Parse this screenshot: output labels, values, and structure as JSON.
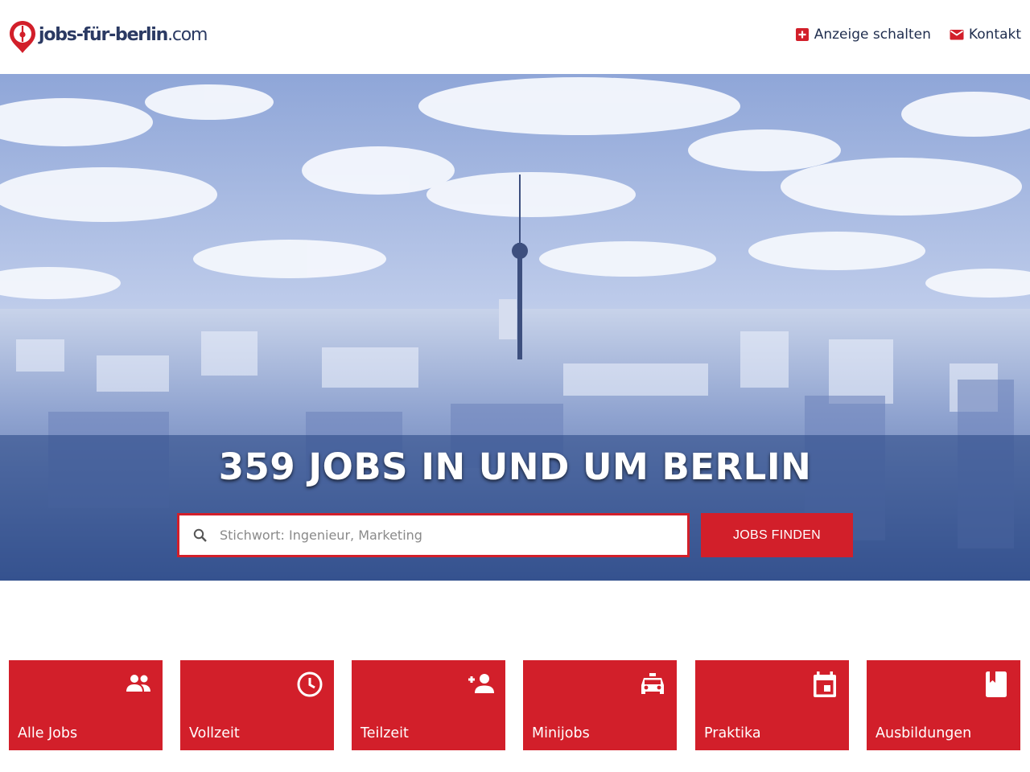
{
  "brand": {
    "name": "jobs-für-berlin",
    "tld": ".com",
    "accent_color": "#d21f2a",
    "text_color": "#2b3a63"
  },
  "nav": {
    "items": [
      {
        "label": "Anzeige schalten",
        "icon": "plus-box-icon"
      },
      {
        "label": "Kontakt",
        "icon": "mail-icon"
      }
    ]
  },
  "hero": {
    "title": "359 JOBS IN UND UM BERLIN",
    "search_placeholder": "Stichwort: Ingenieur, Marketing",
    "search_value": "",
    "search_button": "JOBS FINDEN",
    "search_icon": "search-icon"
  },
  "categories": [
    {
      "label": "Alle Jobs",
      "icon": "people-icon"
    },
    {
      "label": "Vollzeit",
      "icon": "clock-icon"
    },
    {
      "label": "Teilzeit",
      "icon": "person-add-icon"
    },
    {
      "label": "Minijobs",
      "icon": "taxi-icon"
    },
    {
      "label": "Praktika",
      "icon": "calendar-icon"
    },
    {
      "label": "Ausbildungen",
      "icon": "book-icon"
    }
  ]
}
